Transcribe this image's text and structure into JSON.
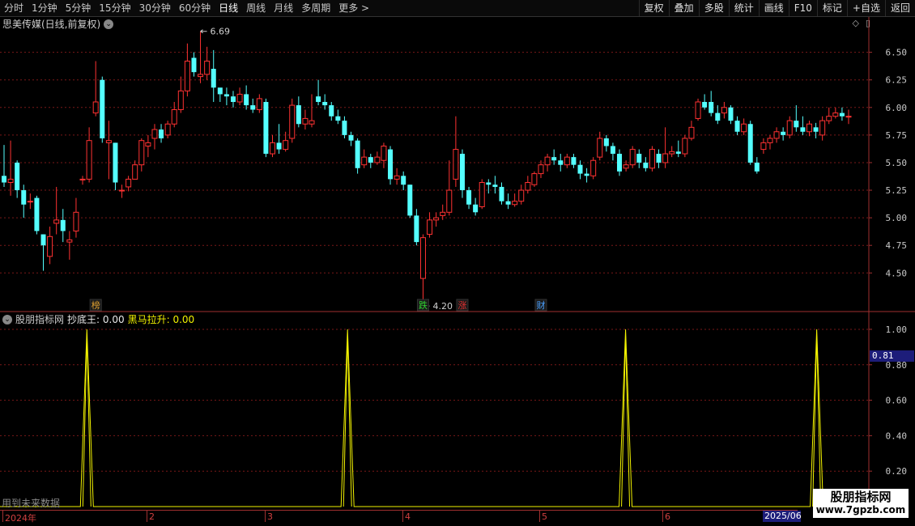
{
  "toolbar": {
    "periods": [
      "分时",
      "1分钟",
      "5分钟",
      "15分钟",
      "30分钟",
      "60分钟",
      "日线",
      "周线",
      "月线",
      "多周期",
      "更多 >"
    ],
    "active_period": "日线",
    "actions": [
      "复权",
      "叠加",
      "多股",
      "统计",
      "画线",
      "F10",
      "标记",
      "+自选",
      "返回"
    ]
  },
  "main_chart": {
    "title": "思美传媒(日线,前复权)",
    "max_label": "6.69",
    "min_label": "4.20",
    "badges": [
      {
        "text": "榜",
        "color": "#e0a030"
      },
      {
        "text": "跌",
        "color": "#30d030"
      },
      {
        "text": "涨",
        "color": "#e03030"
      },
      {
        "text": "财",
        "color": "#4aa0ff"
      }
    ]
  },
  "indicator": {
    "name": "股朋指标网",
    "series1_label": "抄底王: 0.00",
    "series2_label": "黑马拉升: 0.00",
    "current_value": "0.81",
    "note": "用到未来数据"
  },
  "date_axis": {
    "labels": [
      "2024年",
      "2",
      "3",
      "4",
      "5",
      "6"
    ],
    "end_label": "2025/06"
  },
  "watermark": {
    "line1": "股朋指标网",
    "line2": "www.7gpzb.com"
  },
  "chart_data": {
    "type": "candlestick",
    "y_ticks": [
      4.5,
      4.75,
      5.0,
      5.25,
      5.5,
      5.75,
      6.0,
      6.25,
      6.5
    ],
    "ylim": [
      4.15,
      6.82
    ],
    "up_color": "#ff3232",
    "down_color": "#54ffff",
    "candles": [
      [
        5.38,
        5.32,
        5.66,
        5.28
      ],
      [
        5.32,
        5.35,
        5.7,
        5.2
      ],
      [
        5.5,
        5.25,
        5.52,
        5.18
      ],
      [
        5.25,
        5.12,
        5.3,
        5.0
      ],
      [
        5.15,
        5.15,
        5.22,
        5.08
      ],
      [
        5.18,
        4.88,
        5.2,
        4.85
      ],
      [
        4.85,
        4.75,
        4.85,
        4.52
      ],
      [
        4.65,
        4.83,
        4.92,
        4.58
      ],
      [
        4.95,
        4.98,
        5.28,
        4.85
      ],
      [
        4.98,
        4.88,
        5.08,
        4.78
      ],
      [
        4.78,
        4.8,
        4.88,
        4.62
      ],
      [
        4.88,
        5.05,
        5.18,
        4.82
      ],
      [
        5.35,
        5.35,
        5.38,
        5.3
      ],
      [
        5.35,
        5.7,
        5.82,
        5.32
      ],
      [
        5.95,
        6.05,
        6.42,
        5.92
      ],
      [
        6.25,
        5.72,
        6.28,
        5.68
      ],
      [
        5.68,
        5.7,
        5.88,
        5.35
      ],
      [
        5.68,
        5.32,
        5.68,
        5.25
      ],
      [
        5.25,
        5.25,
        5.3,
        5.18
      ],
      [
        5.28,
        5.35,
        5.38,
        5.24
      ],
      [
        5.35,
        5.48,
        5.52,
        5.35
      ],
      [
        5.48,
        5.7,
        5.72,
        5.42
      ],
      [
        5.65,
        5.68,
        5.75,
        5.55
      ],
      [
        5.72,
        5.8,
        5.85,
        5.62
      ],
      [
        5.8,
        5.72,
        5.85,
        5.68
      ],
      [
        5.75,
        5.85,
        5.88,
        5.72
      ],
      [
        5.85,
        5.98,
        6.05,
        5.82
      ],
      [
        5.98,
        6.15,
        6.28,
        5.95
      ],
      [
        6.15,
        6.42,
        6.58,
        6.1
      ],
      [
        6.45,
        6.32,
        6.5,
        6.28
      ],
      [
        6.28,
        6.3,
        6.69,
        6.22
      ],
      [
        6.3,
        6.42,
        6.55,
        6.25
      ],
      [
        6.35,
        6.18,
        6.52,
        6.05
      ],
      [
        6.18,
        6.12,
        6.15,
        6.05
      ],
      [
        6.12,
        6.1,
        6.18,
        6.02
      ],
      [
        6.1,
        6.05,
        6.15,
        6.0
      ],
      [
        6.05,
        6.12,
        6.18,
        6.02
      ],
      [
        6.12,
        6.02,
        6.2,
        5.98
      ],
      [
        6.02,
        5.98,
        6.08,
        5.95
      ],
      [
        5.98,
        6.08,
        6.12,
        5.95
      ],
      [
        6.05,
        5.58,
        6.08,
        5.55
      ],
      [
        5.58,
        5.68,
        5.75,
        5.55
      ],
      [
        5.68,
        5.62,
        5.85,
        5.58
      ],
      [
        5.62,
        5.7,
        5.78,
        5.6
      ],
      [
        5.72,
        6.02,
        6.08,
        5.68
      ],
      [
        6.02,
        5.85,
        6.1,
        5.82
      ],
      [
        5.85,
        5.9,
        5.98,
        5.8
      ],
      [
        5.85,
        5.88,
        6.12,
        5.82
      ],
      [
        6.1,
        6.05,
        6.25,
        6.02
      ],
      [
        6.05,
        6.02,
        6.12,
        5.98
      ],
      [
        6.02,
        5.92,
        6.05,
        5.88
      ],
      [
        5.92,
        5.88,
        5.98,
        5.85
      ],
      [
        5.88,
        5.75,
        5.92,
        5.72
      ],
      [
        5.75,
        5.7,
        5.78,
        5.65
      ],
      [
        5.7,
        5.45,
        5.72,
        5.4
      ],
      [
        5.48,
        5.55,
        5.62,
        5.45
      ],
      [
        5.55,
        5.5,
        5.58,
        5.45
      ],
      [
        5.5,
        5.55,
        5.6,
        5.48
      ],
      [
        5.52,
        5.65,
        5.68,
        5.45
      ],
      [
        5.62,
        5.35,
        5.65,
        5.3
      ],
      [
        5.35,
        5.38,
        5.45,
        5.3
      ],
      [
        5.38,
        5.3,
        5.42,
        5.25
      ],
      [
        5.3,
        5.02,
        5.3,
        5.0
      ],
      [
        5.02,
        4.78,
        5.08,
        4.75
      ],
      [
        4.45,
        4.82,
        4.85,
        4.2
      ],
      [
        4.85,
        4.98,
        5.05,
        4.82
      ],
      [
        4.98,
        5.0,
        5.05,
        4.92
      ],
      [
        5.02,
        5.05,
        5.12,
        4.98
      ],
      [
        5.05,
        5.25,
        5.52,
        5.02
      ],
      [
        5.35,
        5.62,
        5.92,
        5.28
      ],
      [
        5.58,
        5.25,
        5.62,
        5.18
      ],
      [
        5.25,
        5.12,
        5.28,
        5.08
      ],
      [
        5.12,
        5.05,
        5.18,
        5.02
      ],
      [
        5.1,
        5.32,
        5.35,
        5.08
      ],
      [
        5.32,
        5.3,
        5.35,
        5.22
      ],
      [
        5.3,
        5.28,
        5.38,
        5.22
      ],
      [
        5.28,
        5.15,
        5.32,
        5.12
      ],
      [
        5.15,
        5.12,
        5.22,
        5.08
      ],
      [
        5.12,
        5.15,
        5.22,
        5.1
      ],
      [
        5.15,
        5.25,
        5.3,
        5.12
      ],
      [
        5.25,
        5.32,
        5.38,
        5.22
      ],
      [
        5.3,
        5.4,
        5.42,
        5.28
      ],
      [
        5.4,
        5.48,
        5.52,
        5.36
      ],
      [
        5.48,
        5.55,
        5.58,
        5.42
      ],
      [
        5.55,
        5.52,
        5.62,
        5.48
      ],
      [
        5.52,
        5.48,
        5.58,
        5.42
      ],
      [
        5.48,
        5.55,
        5.58,
        5.45
      ],
      [
        5.55,
        5.48,
        5.58,
        5.45
      ],
      [
        5.48,
        5.4,
        5.52,
        5.35
      ],
      [
        5.4,
        5.38,
        5.45,
        5.32
      ],
      [
        5.38,
        5.52,
        5.55,
        5.35
      ],
      [
        5.55,
        5.72,
        5.78,
        5.52
      ],
      [
        5.72,
        5.65,
        5.75,
        5.6
      ],
      [
        5.65,
        5.58,
        5.68,
        5.52
      ],
      [
        5.58,
        5.42,
        5.62,
        5.38
      ],
      [
        5.45,
        5.48,
        5.52,
        5.42
      ],
      [
        5.48,
        5.62,
        5.65,
        5.45
      ],
      [
        5.58,
        5.5,
        5.62,
        5.45
      ],
      [
        5.5,
        5.45,
        5.55,
        5.42
      ],
      [
        5.45,
        5.62,
        5.65,
        5.42
      ],
      [
        5.58,
        5.5,
        5.62,
        5.45
      ],
      [
        5.5,
        5.58,
        5.82,
        5.45
      ],
      [
        5.58,
        5.6,
        5.65,
        5.55
      ],
      [
        5.6,
        5.58,
        5.7,
        5.55
      ],
      [
        5.58,
        5.72,
        5.75,
        5.55
      ],
      [
        5.72,
        5.82,
        5.88,
        5.7
      ],
      [
        5.9,
        6.05,
        6.08,
        5.88
      ],
      [
        6.05,
        6.0,
        6.12,
        5.98
      ],
      [
        6.05,
        5.95,
        6.15,
        5.92
      ],
      [
        5.95,
        5.88,
        6.02,
        5.85
      ],
      [
        5.95,
        6.0,
        6.05,
        5.9
      ],
      [
        6.0,
        5.88,
        6.02,
        5.85
      ],
      [
        5.88,
        5.78,
        5.92,
        5.75
      ],
      [
        5.78,
        5.85,
        5.9,
        5.75
      ],
      [
        5.85,
        5.5,
        5.88,
        5.48
      ],
      [
        5.5,
        5.42,
        5.55,
        5.4
      ],
      [
        5.62,
        5.68,
        5.72,
        5.58
      ],
      [
        5.68,
        5.72,
        5.75,
        5.62
      ],
      [
        5.72,
        5.78,
        5.82,
        5.68
      ],
      [
        5.78,
        5.75,
        5.82,
        5.7
      ],
      [
        5.75,
        5.88,
        5.92,
        5.72
      ],
      [
        5.88,
        5.82,
        6.02,
        5.78
      ],
      [
        5.82,
        5.78,
        5.92,
        5.75
      ],
      [
        5.78,
        5.85,
        5.88,
        5.74
      ],
      [
        5.82,
        5.78,
        5.86,
        5.72
      ],
      [
        5.75,
        5.88,
        5.92,
        5.7
      ],
      [
        5.88,
        5.92,
        6.0,
        5.85
      ],
      [
        5.92,
        5.95,
        6.0,
        5.9
      ],
      [
        5.95,
        5.92,
        6.0,
        5.88
      ],
      [
        5.92,
        5.92,
        5.98,
        5.85
      ]
    ],
    "indicator_ylim": [
      0,
      1.05
    ],
    "indicator_ticks": [
      0.2,
      0.4,
      0.6,
      0.8,
      1.0
    ],
    "indicator_spikes": [
      0.1,
      0.4,
      0.72,
      0.94
    ],
    "indicator_spike_value": 1.0,
    "indicator_color": "#f2f200"
  }
}
